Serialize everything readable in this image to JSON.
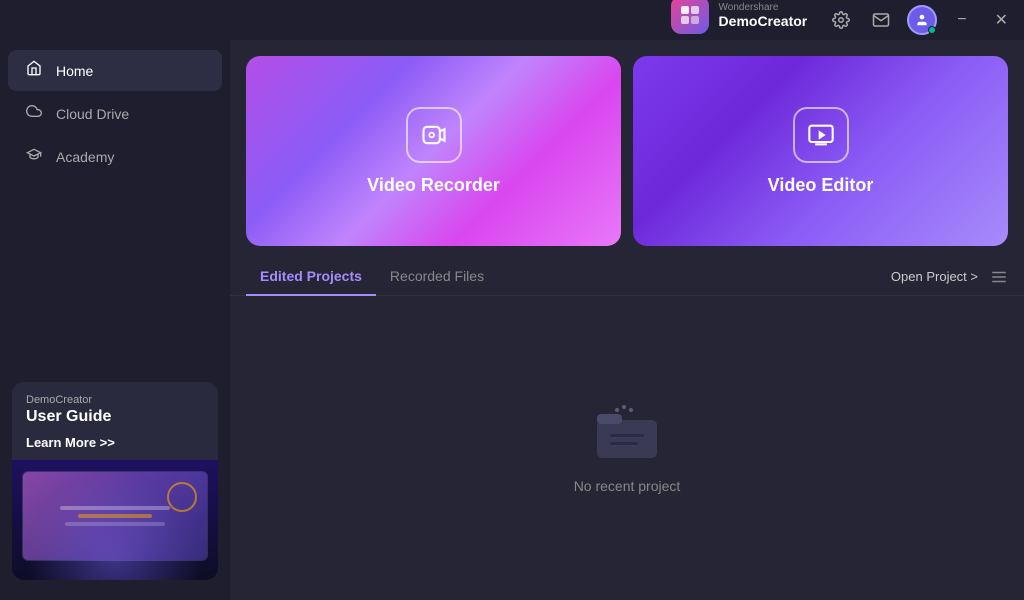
{
  "app": {
    "brand": "Wondershare",
    "product": "DemoCreator"
  },
  "titlebar": {
    "settings_icon": "⚙",
    "mail_icon": "✉",
    "account_icon": "👤",
    "minimize_icon": "−",
    "close_icon": "✕"
  },
  "sidebar": {
    "nav_items": [
      {
        "id": "home",
        "label": "Home",
        "icon": "⌂",
        "active": true
      },
      {
        "id": "cloud-drive",
        "label": "Cloud Drive",
        "icon": "☁"
      },
      {
        "id": "academy",
        "label": "Academy",
        "icon": "🎓"
      }
    ],
    "promo": {
      "subtitle": "DemoCreator",
      "title": "User Guide",
      "link_text": "Learn More >>"
    }
  },
  "hero": {
    "cards": [
      {
        "id": "video-recorder",
        "icon": "⊡",
        "label": "Video Recorder"
      },
      {
        "id": "video-editor",
        "icon": "▶",
        "label": "Video Editor"
      }
    ]
  },
  "tabs": {
    "items": [
      {
        "id": "edited-projects",
        "label": "Edited Projects",
        "active": true
      },
      {
        "id": "recorded-files",
        "label": "Recorded Files",
        "active": false
      }
    ],
    "open_project_label": "Open Project >",
    "menu_icon": "☰"
  },
  "empty_state": {
    "message": "No recent project"
  }
}
